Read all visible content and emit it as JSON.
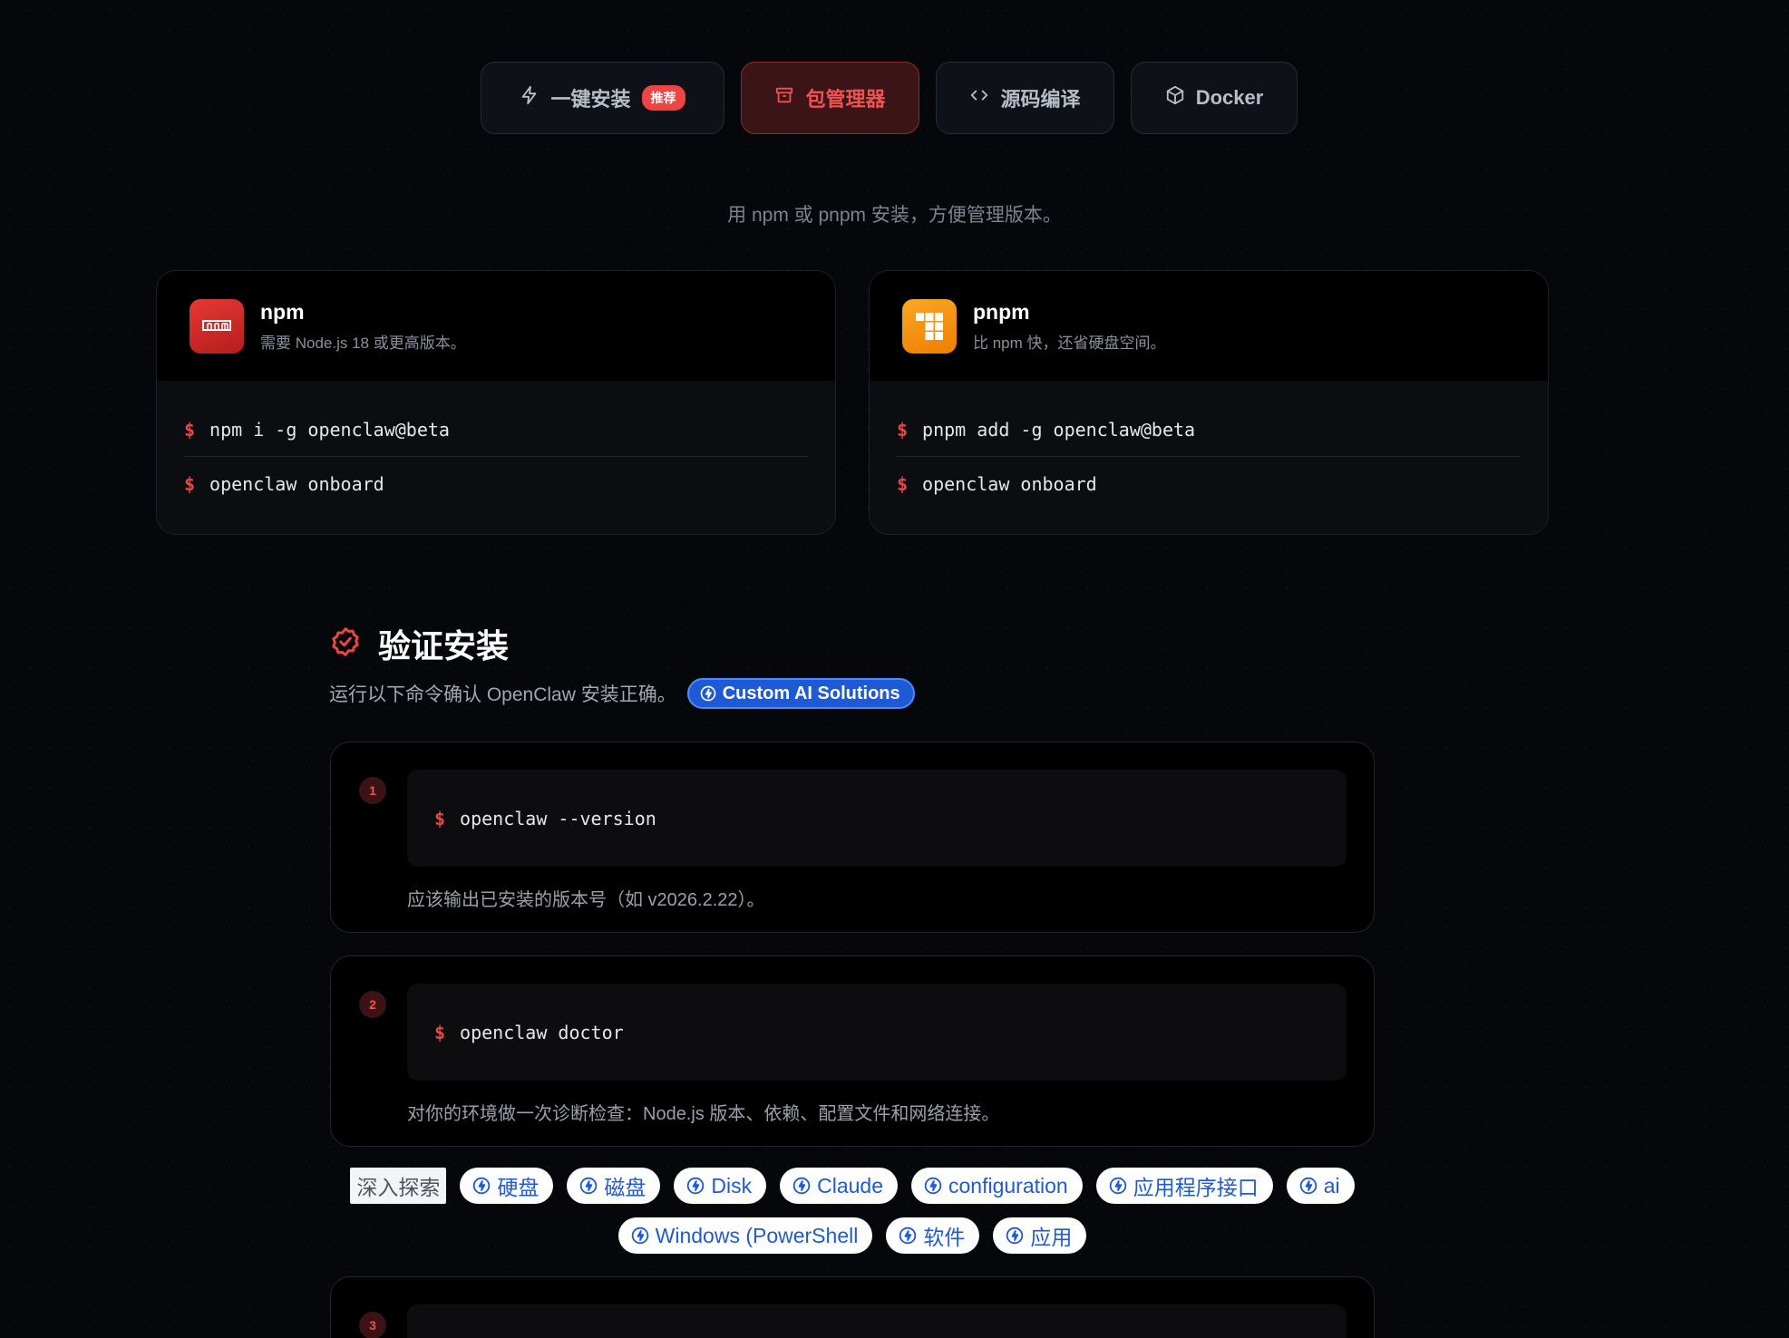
{
  "tabs": [
    {
      "label": "一键安装",
      "badge": "推荐",
      "icon": "bolt-icon"
    },
    {
      "label": "包管理器",
      "icon": "archive-icon",
      "active": true
    },
    {
      "label": "源码编译",
      "icon": "code-icon"
    },
    {
      "label": "Docker",
      "icon": "box-icon"
    }
  ],
  "subtitle": "用 npm 或 pnpm 安装，方便管理版本。",
  "packages": [
    {
      "name": "npm",
      "desc": "需要 Node.js 18 或更高版本。",
      "prompt": "$",
      "commands": [
        "npm i -g openclaw@beta",
        "openclaw onboard"
      ]
    },
    {
      "name": "pnpm",
      "desc": "比 npm 快，还省硬盘空间。",
      "prompt": "$",
      "commands": [
        "pnpm add -g openclaw@beta",
        "openclaw onboard"
      ]
    }
  ],
  "verify": {
    "title": "验证安装",
    "desc": "运行以下命令确认 OpenClaw 安装正确。",
    "link": "Custom AI Solutions",
    "steps": [
      {
        "num": "1",
        "prompt": "$",
        "command": "openclaw --version",
        "note": "应该输出已安装的版本号（如 v2026.2.22）。"
      },
      {
        "num": "2",
        "prompt": "$",
        "command": "openclaw doctor",
        "note": "对你的环境做一次诊断检查：Node.js 版本、依赖、配置文件和网络连接。"
      },
      {
        "num": "3",
        "prompt": "",
        "command": "",
        "note": ""
      }
    ]
  },
  "explore": {
    "label": "深入探索",
    "chips": [
      "硬盘",
      "磁盘",
      "Disk",
      "Claude",
      "configuration",
      "应用程序接口",
      "ai",
      "Windows (PowerShell",
      "软件",
      "应用"
    ]
  },
  "colors": {
    "accent": "#ef4444",
    "link": "#1f5ad6",
    "background": "#05070b"
  }
}
